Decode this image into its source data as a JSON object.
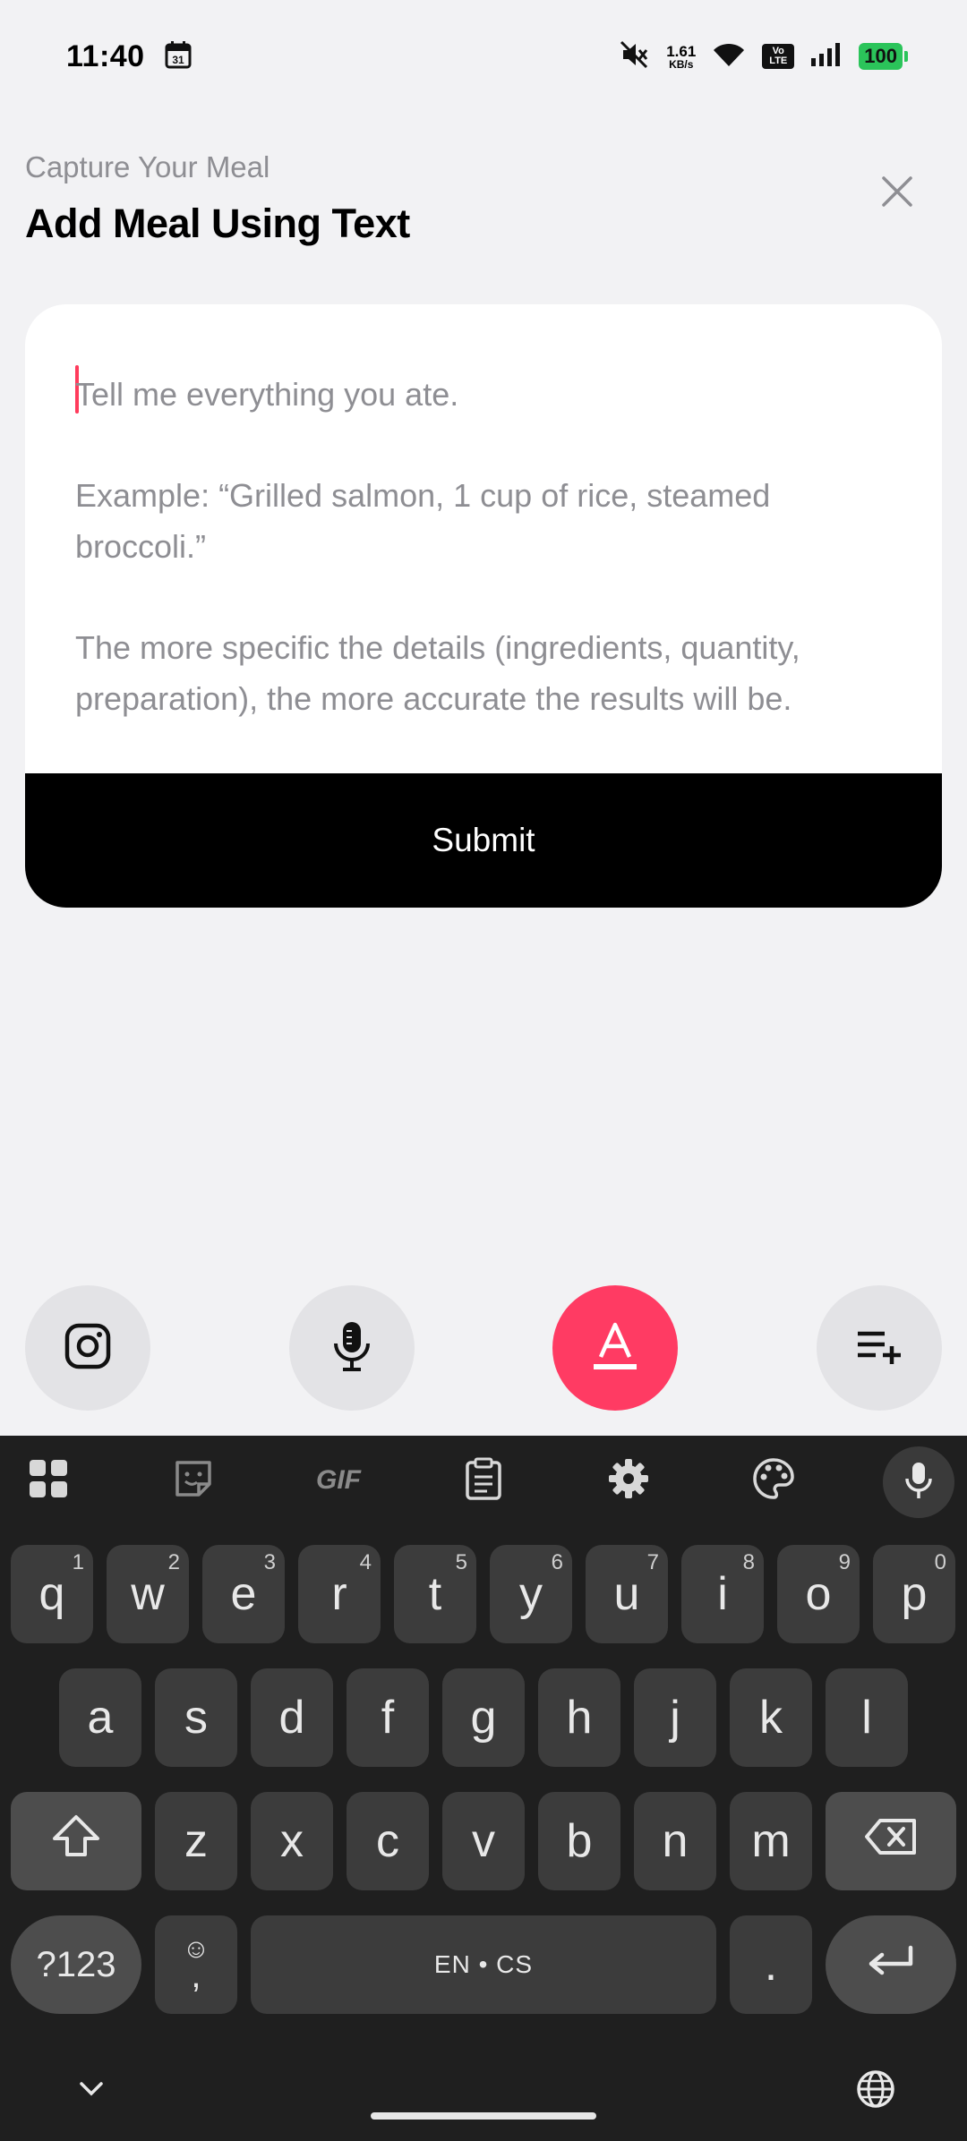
{
  "status_bar": {
    "time": "11:40",
    "calendar_day": "31",
    "net_speed_value": "1.61",
    "net_speed_unit": "KB/s",
    "volte_top": "Vo",
    "volte_bottom": "LTE",
    "battery": "100"
  },
  "header": {
    "subtitle": "Capture Your Meal",
    "title": "Add Meal Using Text"
  },
  "input": {
    "placeholder_line1": "Tell me everything you ate.",
    "placeholder_line2": "Example: “Grilled salmon, 1 cup of rice, steamed broccoli.”",
    "placeholder_line3": "The more specific the details (ingredients, quantity, preparation), the more accurate the results will be."
  },
  "submit_label": "Submit",
  "mode_buttons": [
    "instagram-icon",
    "microphone-icon",
    "text-icon",
    "add-to-list-icon"
  ],
  "keyboard": {
    "row1": [
      {
        "k": "q",
        "s": "1"
      },
      {
        "k": "w",
        "s": "2"
      },
      {
        "k": "e",
        "s": "3"
      },
      {
        "k": "r",
        "s": "4"
      },
      {
        "k": "t",
        "s": "5"
      },
      {
        "k": "y",
        "s": "6"
      },
      {
        "k": "u",
        "s": "7"
      },
      {
        "k": "i",
        "s": "8"
      },
      {
        "k": "o",
        "s": "9"
      },
      {
        "k": "p",
        "s": "0"
      }
    ],
    "row2": [
      "a",
      "s",
      "d",
      "f",
      "g",
      "h",
      "j",
      "k",
      "l"
    ],
    "row3": [
      "z",
      "x",
      "c",
      "v",
      "b",
      "n",
      "m"
    ],
    "symbols_label": "?123",
    "emoji_symbol": "☺",
    "comma_label": ",",
    "space_label": "EN • CS",
    "period_label": ".",
    "toolbar_gif_label": "GIF"
  },
  "colors": {
    "accent": "#ff3b63",
    "background": "#f2f2f4",
    "keyboard_bg": "#1f1f1f",
    "key_bg": "#3c3c3c"
  }
}
